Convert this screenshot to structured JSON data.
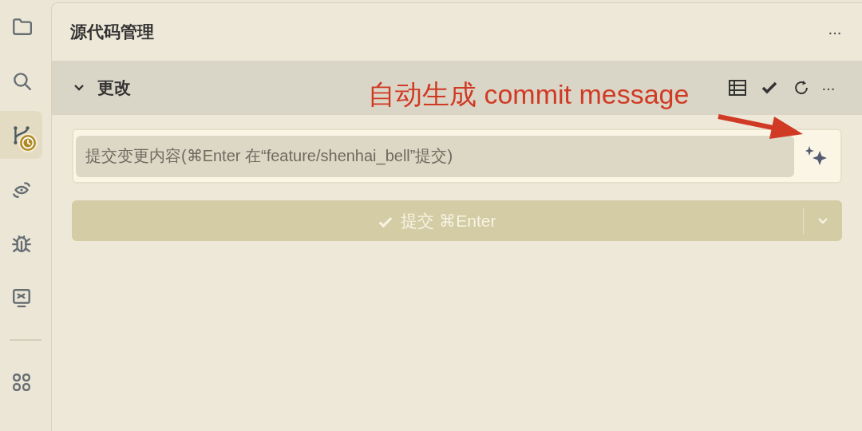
{
  "activity_bar": {
    "items": [
      {
        "kind": "folder",
        "selected": false
      },
      {
        "kind": "search",
        "selected": false
      },
      {
        "kind": "source-control",
        "selected": true,
        "badge": true
      },
      {
        "kind": "eye",
        "selected": false
      },
      {
        "kind": "bug",
        "selected": false
      },
      {
        "kind": "remote",
        "selected": false
      },
      {
        "kind": "divider"
      },
      {
        "kind": "grid",
        "selected": false
      }
    ]
  },
  "panel": {
    "title": "源代码管理",
    "more": "···",
    "section": {
      "title": "更改",
      "expanded": true,
      "more": "···"
    },
    "message_field": {
      "placeholder": "提交变更内容(⌘Enter 在“feature/shenhai_bell”提交)"
    },
    "commit_button": {
      "label": "提交 ⌘Enter",
      "disabled": true
    }
  },
  "annotation": {
    "text": "自动生成 commit message"
  }
}
